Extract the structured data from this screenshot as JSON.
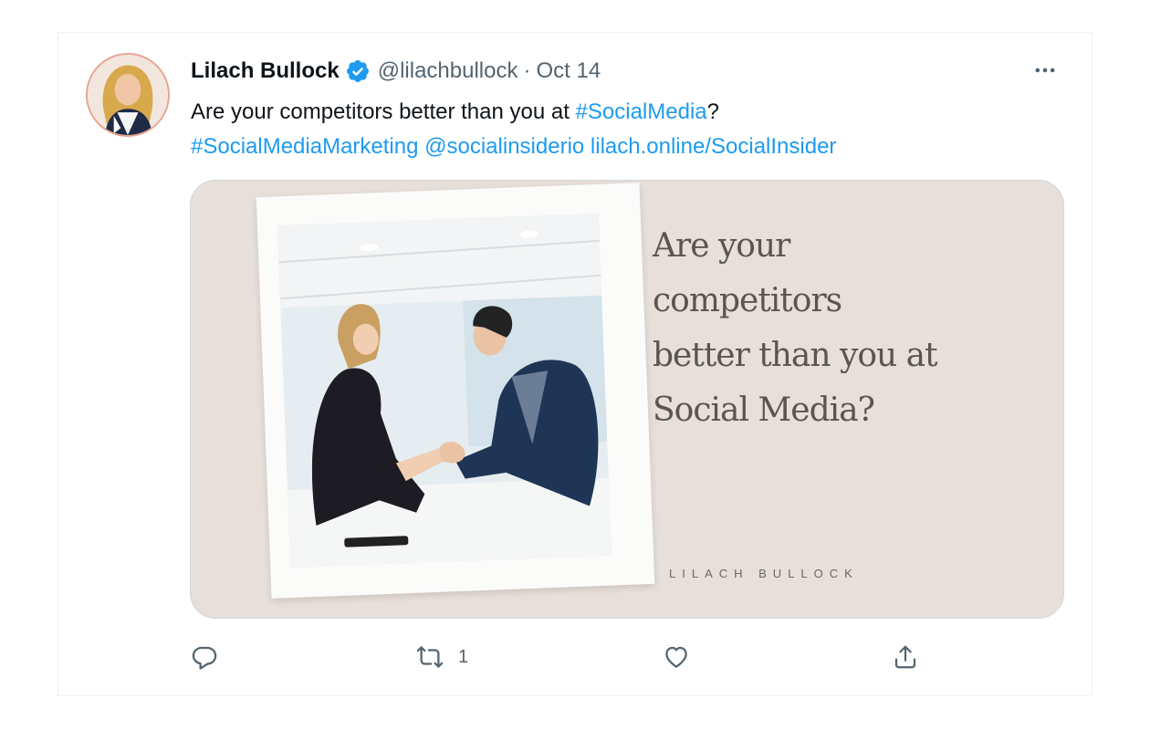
{
  "tweet": {
    "author": {
      "display_name": "Lilach Bullock",
      "handle": "@lilachbullock",
      "verified": true,
      "avatar_icon": "profile-photo"
    },
    "separator": "·",
    "date": "Oct 14",
    "more_icon": "more-options-icon",
    "text": {
      "line1_plain": "Are your competitors better than you at ",
      "line1_hashtag": "#SocialMedia",
      "line1_end": "?",
      "line2_hashtag": "#SocialMediaMarketing",
      "line2_mention": "@socialinsiderio",
      "line2_link": "lilach.online/SocialInsider"
    },
    "media": {
      "heading_lines": [
        "Are your",
        "competitors",
        "better than you at",
        "Social Media?"
      ],
      "signature": "LILACH BULLOCK"
    },
    "actions": {
      "reply_icon": "reply-icon",
      "retweet_icon": "retweet-icon",
      "retweet_count": "1",
      "like_icon": "like-icon",
      "share_icon": "share-icon"
    },
    "colors": {
      "link": "#1d9bf0",
      "secondary_text": "#536471",
      "verified_badge": "#1d9bf0",
      "media_background": "#e7dfd9"
    }
  }
}
